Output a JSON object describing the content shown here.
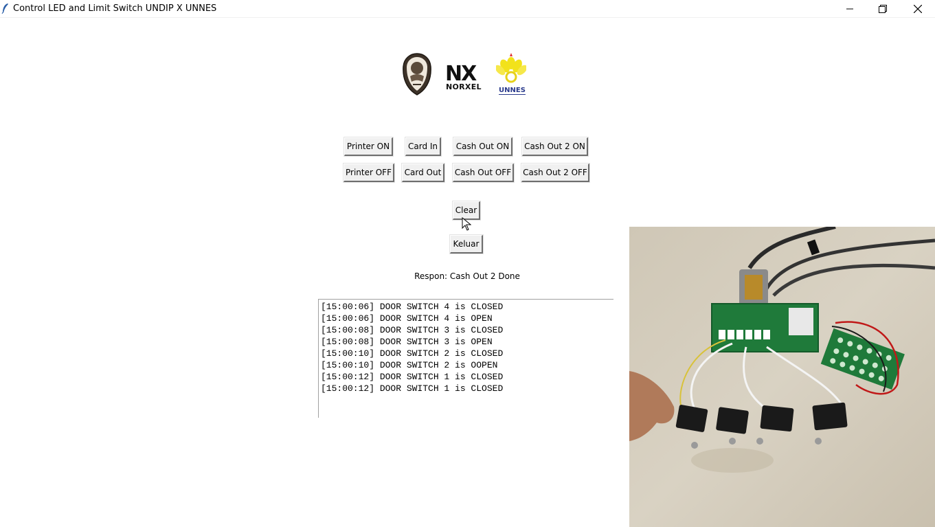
{
  "window": {
    "title": "Control LED and Limit Switch UNDIP X UNNES",
    "minimize_icon": "minimize-icon",
    "restore_icon": "restore-icon",
    "close_icon": "close-icon"
  },
  "logos": {
    "undip": "undip-seal-logo",
    "norxel_mark": "NX",
    "norxel_word": "NORXEL",
    "unnes_word": "UNNES"
  },
  "buttons": {
    "row1": [
      "Printer ON",
      "Card In",
      "Cash Out ON",
      "Cash Out 2 ON"
    ],
    "row2": [
      "Printer OFF",
      "Card Out",
      "Cash Out OFF",
      "Cash Out 2 OFF"
    ],
    "clear": "Clear",
    "exit": "Keluar"
  },
  "response": "Respon: Cash Out 2 Done",
  "log": [
    "[15:00:06] DOOR SWITCH 4 is CLOSED",
    "[15:00:06] DOOR SWITCH 4 is OPEN",
    "[15:00:08] DOOR SWITCH 3 is CLOSED",
    "[15:00:08] DOOR SWITCH 3 is OPEN",
    "[15:00:10] DOOR SWITCH 2 is CLOSED",
    "[15:00:10] DOOR SWITCH 2 is OOPEN",
    "[15:00:12] DOOR SWITCH 1 is CLOSED",
    "[15:00:12] DOOR SWITCH 1 is CLOSED"
  ],
  "colors": {
    "unnes_yellow": "#f2e21b",
    "unnes_blue": "#2a3a8c",
    "pcb_green": "#1f7a3a",
    "table_surface": "#d6cfc0"
  }
}
